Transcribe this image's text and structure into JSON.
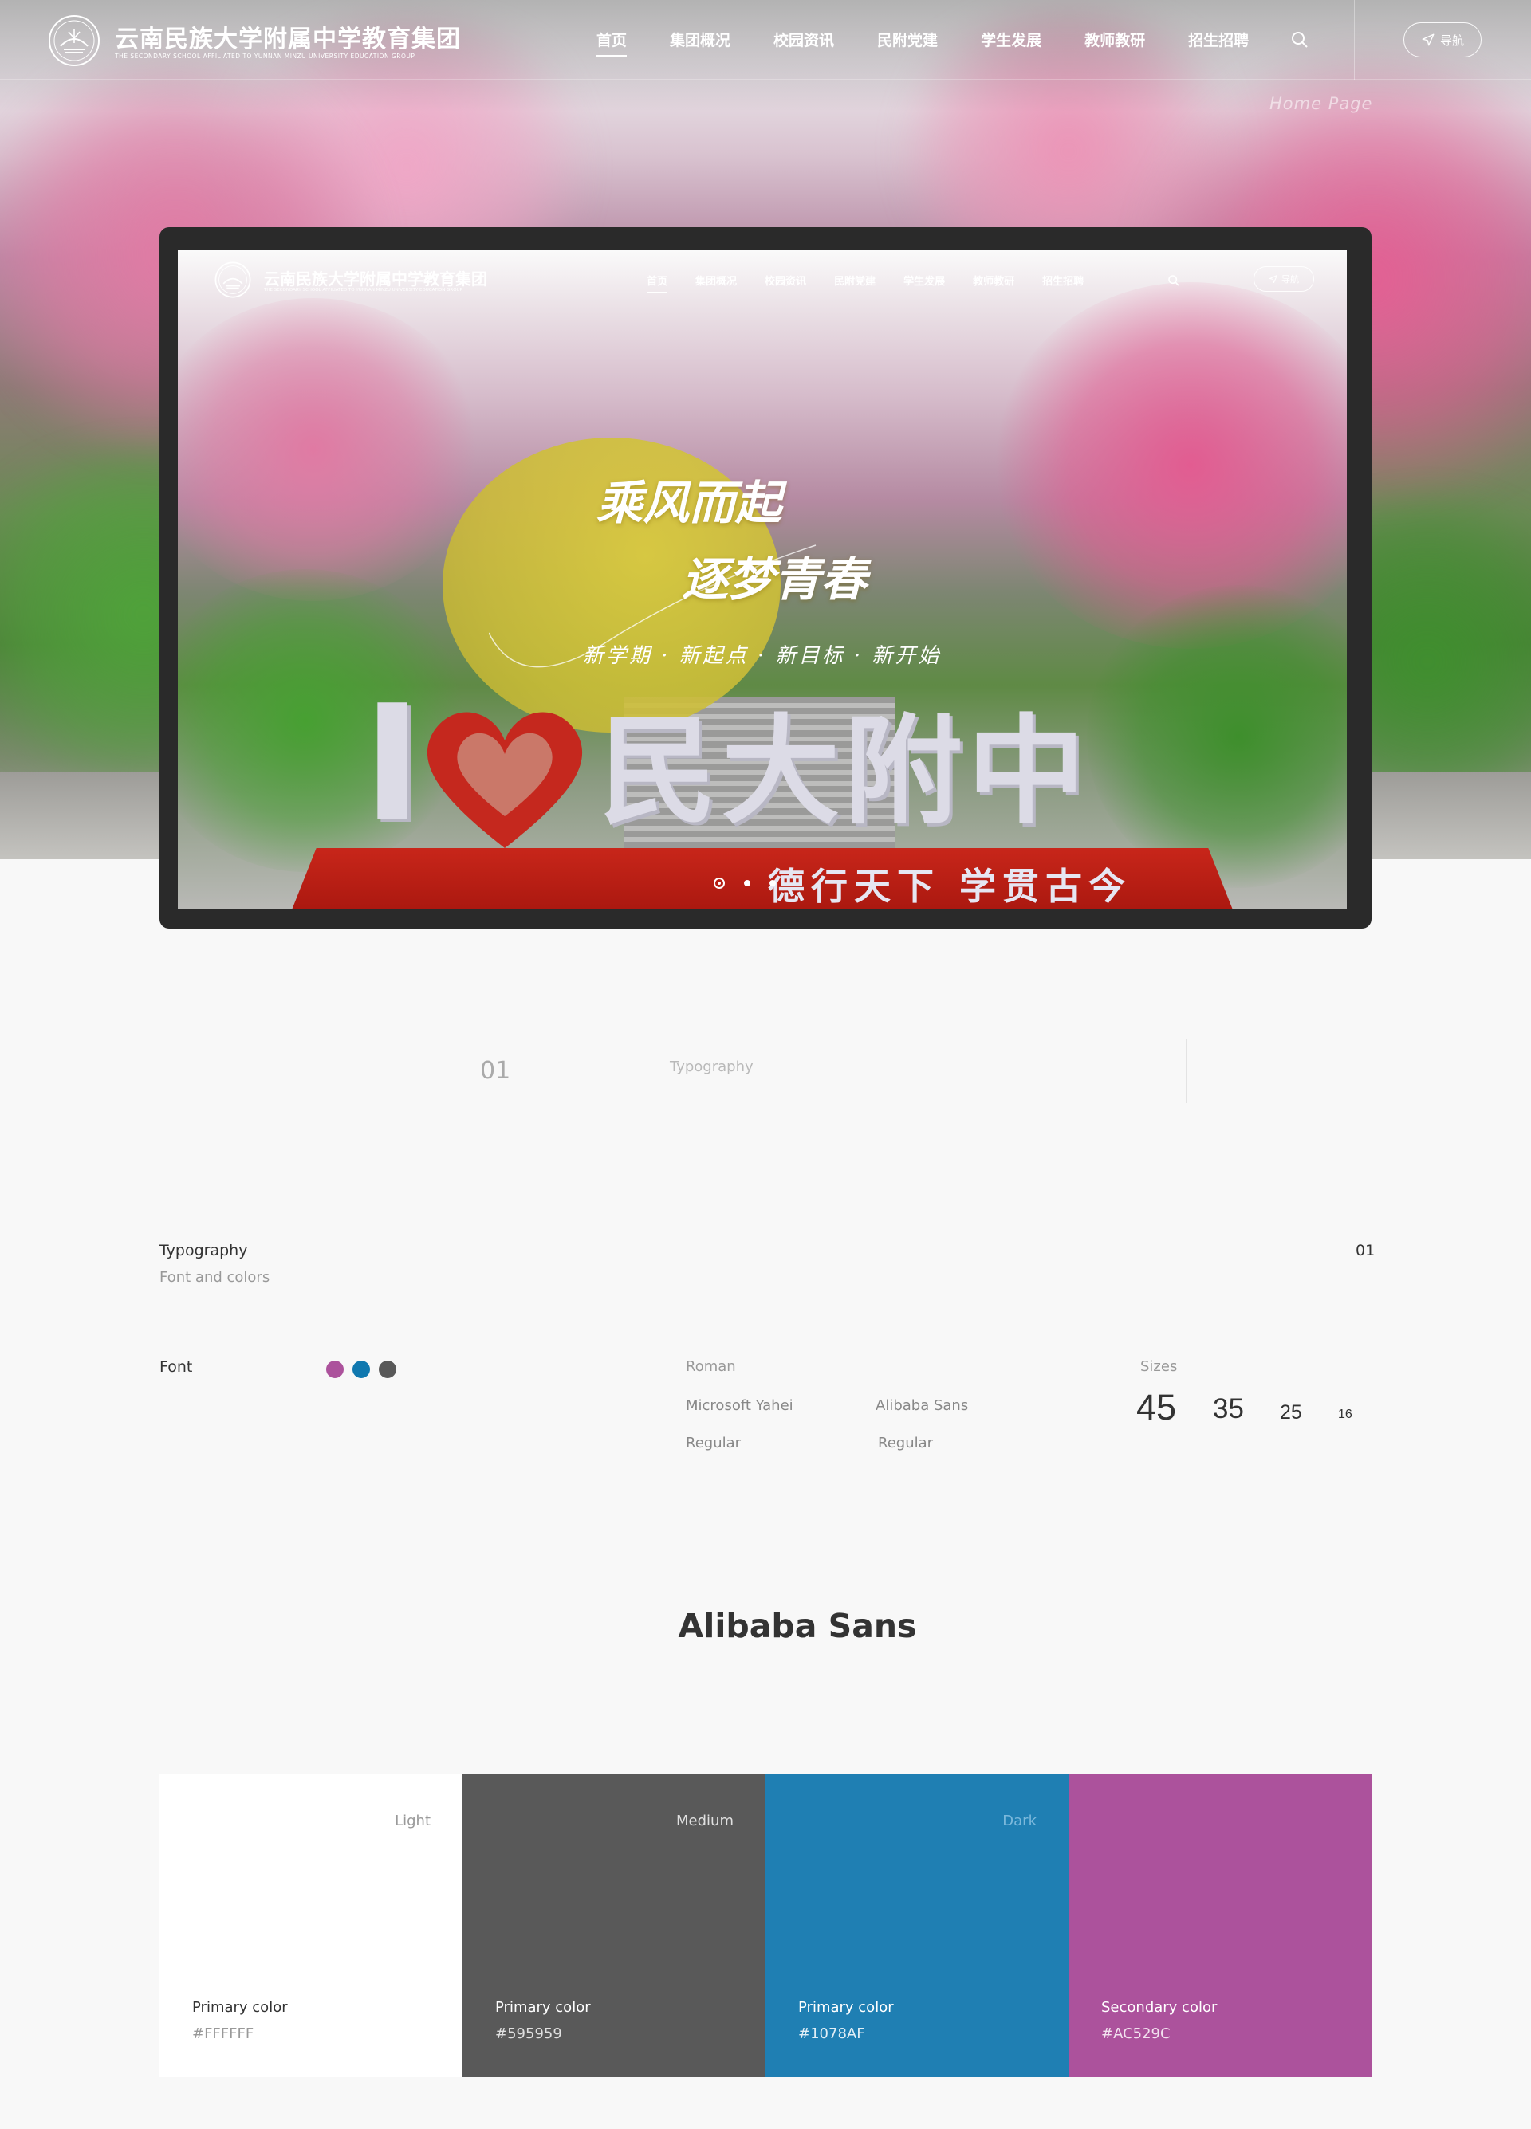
{
  "header": {
    "logo_cn": "云南民族大学附属中学教育集团",
    "logo_en": "THE SECONDARY SCHOOL AFFILIATED TO YUNNAN MINZU UNIVERSITY EDUCATION GROUP",
    "nav": [
      "首页",
      "集团概况",
      "校园资讯",
      "民附党建",
      "学生发展",
      "教师教研",
      "招生招聘"
    ],
    "search_icon": "search-icon",
    "nav_button_label": "导航",
    "nav_button_icon": "send-icon",
    "home_tag": "Home Page"
  },
  "mockup": {
    "logo_cn": "云南民族大学附属中学教育集团",
    "logo_en": "THE SECONDARY SCHOOL AFFILIATED TO YUNNAN MINZU UNIVERSITY EDUCATION GROUP",
    "nav": [
      "首页",
      "集团概况",
      "校园资讯",
      "民附党建",
      "学生发展",
      "教师教研",
      "招生招聘"
    ],
    "nav_button_label": "导航",
    "slogan_line1": "乘风而起",
    "slogan_line2": "逐梦青春",
    "slogan_line3": "新学期 · 新起点 · 新目标 · 新开始",
    "sign_i": "I",
    "sign_text": "民大附中",
    "motto": "德行天下  学贯古今"
  },
  "section": {
    "number": "01",
    "label": "Typography"
  },
  "typography": {
    "title": "Typography",
    "subtitle": "Font and colors",
    "number": "01",
    "font_label": "Font",
    "swatches": [
      "#AC529C",
      "#1078AF",
      "#595959"
    ],
    "roman_label": "Roman",
    "font_names": [
      "Microsoft Yahei",
      "Alibaba Sans"
    ],
    "font_weights": [
      "Regular",
      "Regular"
    ],
    "sizes_label": "Sizes",
    "sizes": [
      "45",
      "35",
      "25",
      "16"
    ],
    "showcase": "Alibaba Sans"
  },
  "colors": [
    {
      "tone": "Light",
      "name": "Primary color",
      "hex": "#FFFFFF",
      "bg": "#FFFFFF",
      "fg": "#333333",
      "tone_color": "#999999",
      "hex_color": "#999999"
    },
    {
      "tone": "Medium",
      "name": "Primary color",
      "hex": "#595959",
      "bg": "#595959",
      "fg": "#FFFFFF",
      "tone_color": "#E0E0E0",
      "hex_color": "#E0E0E0"
    },
    {
      "tone": "Dark",
      "name": "Primary color",
      "hex": "#1078AF",
      "bg": "#1F7FB3",
      "fg": "#FFFFFF",
      "tone_color": "#7CB9DC",
      "hex_color": "#E0EEF6"
    },
    {
      "tone": "",
      "name": "Secondary color",
      "hex": "#AC529C",
      "bg": "#AC529C",
      "fg": "#FFFFFF",
      "tone_color": "#FFFFFF",
      "hex_color": "#F2E2EF"
    }
  ]
}
